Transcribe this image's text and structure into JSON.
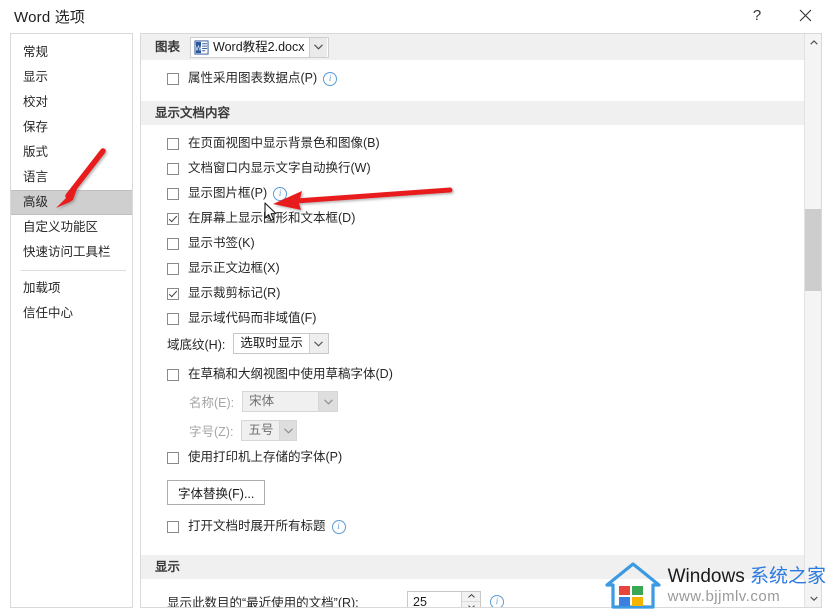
{
  "window": {
    "title": "Word 选项",
    "help_label": "?",
    "close_label": "×"
  },
  "sidebar": {
    "items": [
      {
        "label": "常规",
        "name": "general",
        "selected": false
      },
      {
        "label": "显示",
        "name": "display",
        "selected": false
      },
      {
        "label": "校对",
        "name": "proofing",
        "selected": false
      },
      {
        "label": "保存",
        "name": "save",
        "selected": false
      },
      {
        "label": "版式",
        "name": "layout",
        "selected": false
      },
      {
        "label": "语言",
        "name": "language",
        "selected": false
      },
      {
        "label": "高级",
        "name": "advanced",
        "selected": true
      },
      {
        "label": "自定义功能区",
        "name": "customize-ribbon",
        "selected": false
      },
      {
        "label": "快速访问工具栏",
        "name": "quick-access",
        "selected": false
      },
      {
        "label": "加载项",
        "name": "add-ins",
        "selected": false
      },
      {
        "label": "信任中心",
        "name": "trust-center",
        "selected": false
      }
    ]
  },
  "content": {
    "chart_band": {
      "label": "图表",
      "document_name": "Word教程2.docx",
      "doc_icon": "word-document-icon",
      "dropdown_icon": "chevron-down-icon"
    },
    "chart_option": {
      "label": "属性采用图表数据点(P)",
      "mnemonic": "P",
      "checked": false,
      "info_icon": "info-icon"
    },
    "section_document_content": {
      "header": "显示文档内容",
      "options": [
        {
          "label": "在页面视图中显示背景色和图像(B)",
          "checked": false,
          "info": false
        },
        {
          "label": "文档窗口内显示文字自动换行(W)",
          "checked": false,
          "info": false
        },
        {
          "label": "显示图片框(P)",
          "checked": false,
          "info": true
        },
        {
          "label": "在屏幕上显示图形和文本框(D)",
          "checked": true,
          "info": false
        },
        {
          "label": "显示书签(K)",
          "checked": false,
          "info": false
        },
        {
          "label": "显示正文边框(X)",
          "checked": false,
          "info": false
        },
        {
          "label": "显示裁剪标记(R)",
          "checked": true,
          "info": false
        },
        {
          "label": "显示域代码而非域值(F)",
          "checked": false,
          "info": false
        }
      ],
      "field_shading": {
        "label": "域底纹(H):",
        "value": "选取时显示",
        "dropdown_icon": "chevron-down-icon"
      },
      "draft_font": {
        "label": "在草稿和大纲视图中使用草稿字体(D)",
        "checked": false
      },
      "font_name": {
        "label": "名称(E):",
        "value": "宋体",
        "disabled": true,
        "dropdown_icon": "chevron-down-icon"
      },
      "font_size": {
        "label": "字号(Z):",
        "value": "五号",
        "disabled": true,
        "dropdown_icon": "chevron-down-icon"
      },
      "printer_fonts": {
        "label": "使用打印机上存储的字体(P)",
        "checked": false
      },
      "font_substitution_button": "字体替换(F)...",
      "expand_headings": {
        "label": "打开文档时展开所有标题",
        "checked": false,
        "info": true
      }
    },
    "section_display": {
      "header": "显示",
      "recent_docs": {
        "label": "显示此数目的“最近使用的文档”(R):",
        "value": "25",
        "info_icon": "info-icon",
        "up_icon": "spinner-up-icon",
        "down_icon": "spinner-down-icon"
      }
    }
  },
  "scrollbar": {
    "up_icon": "scroll-up-icon",
    "down_icon": "scroll-down-icon",
    "thumb": "scroll-thumb"
  },
  "annotations": {
    "arrow_sidebar": "red-arrow-pointing-to-advanced",
    "arrow_content": "red-arrow-pointing-to-show-picture-placeholders",
    "color": "#e81d1d"
  },
  "watermark": {
    "brand": "Windows",
    "brand_cn": "系统之家",
    "url": "www.bjjmlv.com",
    "logo": "windows-house-logo"
  }
}
